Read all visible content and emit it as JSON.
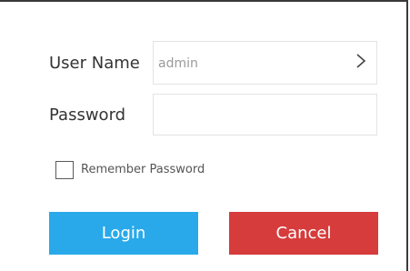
{
  "form": {
    "username_label": "User Name",
    "username_value": "admin",
    "password_label": "Password",
    "password_value": "",
    "remember_label": "Remember Password",
    "remember_checked": false
  },
  "buttons": {
    "login_label": "Login",
    "cancel_label": "Cancel"
  },
  "colors": {
    "login": "#29a9ea",
    "cancel": "#d63c3c"
  },
  "icons": {
    "username_dropdown": "chevron-right-icon"
  }
}
